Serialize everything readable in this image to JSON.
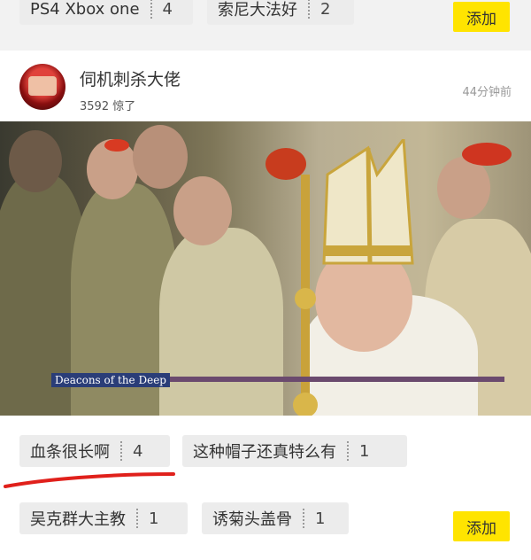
{
  "top_tags": [
    {
      "label": "PS4 Xbox one",
      "count": "4"
    },
    {
      "label": "索尼大法好",
      "count": "2"
    }
  ],
  "top_add_label": "添加",
  "post": {
    "username": "伺机刺杀大佬",
    "shocked_count": "3592 惊了",
    "time": "44分钟前",
    "image_caption": "Deacons of the Deep"
  },
  "bottom_tags": [
    {
      "label": "血条很长啊",
      "count": "4"
    },
    {
      "label": "这种帽子还真特么有",
      "count": "1"
    },
    {
      "label": "吴克群大主教",
      "count": "1"
    },
    {
      "label": "诱菊头盖骨",
      "count": "1"
    }
  ],
  "bottom_add_label": "添加",
  "colors": {
    "add_button": "#ffe400",
    "underline": "#e0201b",
    "caption_bg": "#2a3d78"
  }
}
